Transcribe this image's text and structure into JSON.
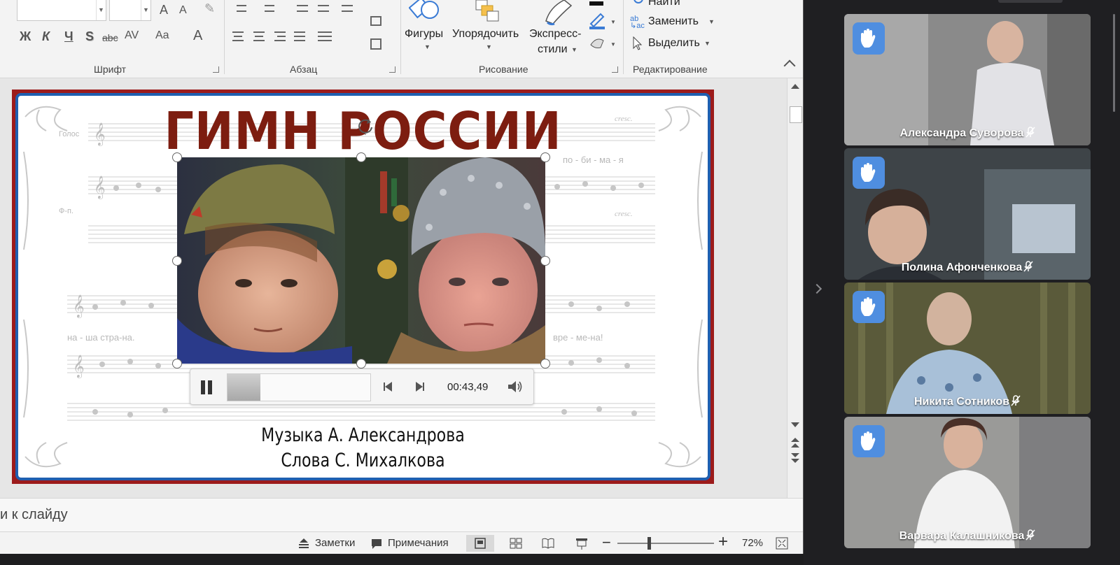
{
  "ribbon": {
    "font_group_label": "Шрифт",
    "paragraph_group_label": "Абзац",
    "drawing_group_label": "Рисование",
    "editing_group_label": "Редактирование",
    "bold": "Ж",
    "italic": "К",
    "underline": "Ч",
    "shadow": "S",
    "strikethrough": "abc",
    "spacing": "AV",
    "case": "Aa",
    "color_a": "A",
    "grow_font": "A",
    "shrink_font": "A",
    "shapes_label": "Фигуры",
    "arrange_label": "Упорядочить",
    "quick_styles_label_1": "Экспресс-",
    "quick_styles_label_2": "стили",
    "find_label": "Найти",
    "replace_label": "Заменить",
    "select_label": "Выделить"
  },
  "slide": {
    "title": "ГИМН РОССИИ",
    "credit_music": "Музыка А. Александрова",
    "credit_words": "Слова С. Михалкова",
    "sheet_label_voice": "Голос",
    "sheet_label_piano": "Ф-п.",
    "lyric_1": "по - би - ма - я",
    "lyric_2": "на - ша стра-на.",
    "lyric_3": "вре - ме-на!",
    "cresc": "cresc."
  },
  "media": {
    "time": "00:43,49",
    "progress_fraction": 0.23
  },
  "notes": {
    "placeholder": "и к слайду"
  },
  "status": {
    "notes_label": "Заметки",
    "comments_label": "Примечания",
    "zoom": "72%"
  },
  "meeting": {
    "participants": [
      {
        "name": "Александра Суворова"
      },
      {
        "name": "Полина Афонченкова"
      },
      {
        "name": "Никита Сотников"
      },
      {
        "name": "Варвара Калашникова"
      }
    ]
  },
  "colors": {
    "slide_border_red": "#9c1b1b",
    "slide_border_blue": "#1f5fb0",
    "title": "#7d1d10",
    "hand_badge": "#4f8ee0"
  }
}
